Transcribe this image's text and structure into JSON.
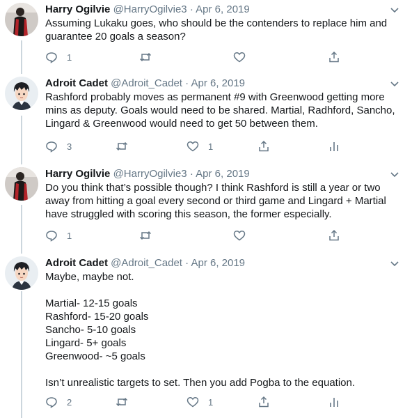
{
  "tweets": [
    {
      "name": "Harry Ogilvie",
      "handle": "@HarryOgilvie3",
      "separator": "·",
      "date": "Apr 6, 2019",
      "text": "Assuming Lukaku goes, who should be the contenders to replace him and guarantee 20 goals a season?",
      "replies": "1",
      "likes": "",
      "avatar_icon": "user-avatar-red-shirt"
    },
    {
      "name": "Adroit Cadet",
      "handle": "@Adroit_Cadet",
      "separator": "·",
      "date": "Apr 6, 2019",
      "text": "Rashford probably moves as permanent #9 with Greenwood getting more mins as deputy. Goals would need to be shared. Martial, Radhford, Sancho, Lingard & Greenwood would need to get 50 between them.",
      "replies": "3",
      "likes": "1",
      "avatar_icon": "cartoon-avatar"
    },
    {
      "name": "Harry Ogilvie",
      "handle": "@HarryOgilvie3",
      "separator": "·",
      "date": "Apr 6, 2019",
      "text": "Do you think that’s possible though? I think Rashford is still a year or two away from hitting a goal every second or third game and Lingard + Martial have struggled with scoring this season, the former especially.",
      "replies": "1",
      "likes": "",
      "avatar_icon": "user-avatar-red-shirt"
    },
    {
      "name": "Adroit Cadet",
      "handle": "@Adroit_Cadet",
      "separator": "·",
      "date": "Apr 6, 2019",
      "text": "Maybe, maybe not.\n\nMartial- 12-15 goals\nRashford- 15-20 goals\nSancho- 5-10 goals\nLingard- 5+ goals\nGreenwood- ~5 goals\n\nIsn’t unrealistic targets to set. Then you add Pogba to the equation.",
      "replies": "2",
      "likes": "1",
      "avatar_icon": "cartoon-avatar"
    }
  ],
  "colors": {
    "text": "#14171a",
    "muted": "#657786",
    "thread_line": "#ccd6dd"
  }
}
